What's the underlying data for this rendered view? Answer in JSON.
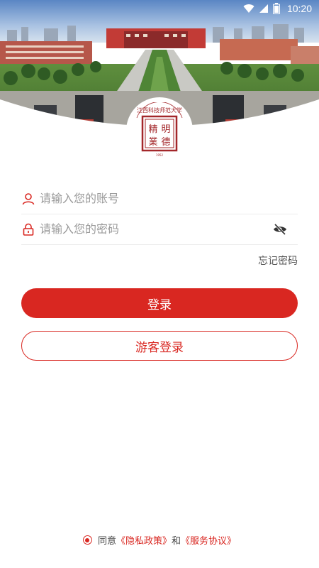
{
  "status_bar": {
    "time": "10:20",
    "icons": [
      "wifi-icon",
      "signal-icon",
      "battery-icon"
    ]
  },
  "logo": {
    "emblem": "university-seal",
    "text": "江西科技师范大学"
  },
  "login_form": {
    "account_placeholder": "请输入您的账号",
    "password_placeholder": "请输入您的密码",
    "account_icon": "user-icon",
    "password_icon": "lock-icon",
    "toggle_icon": "eye-off-icon"
  },
  "forgot_password": "忘记密码",
  "buttons": {
    "login": "登录",
    "guest_login": "游客登录"
  },
  "agreement": {
    "prefix": "同意",
    "privacy": "《隐私政策》",
    "and": "和",
    "service": "《服务协议》"
  },
  "colors": {
    "accent": "#d92721"
  }
}
